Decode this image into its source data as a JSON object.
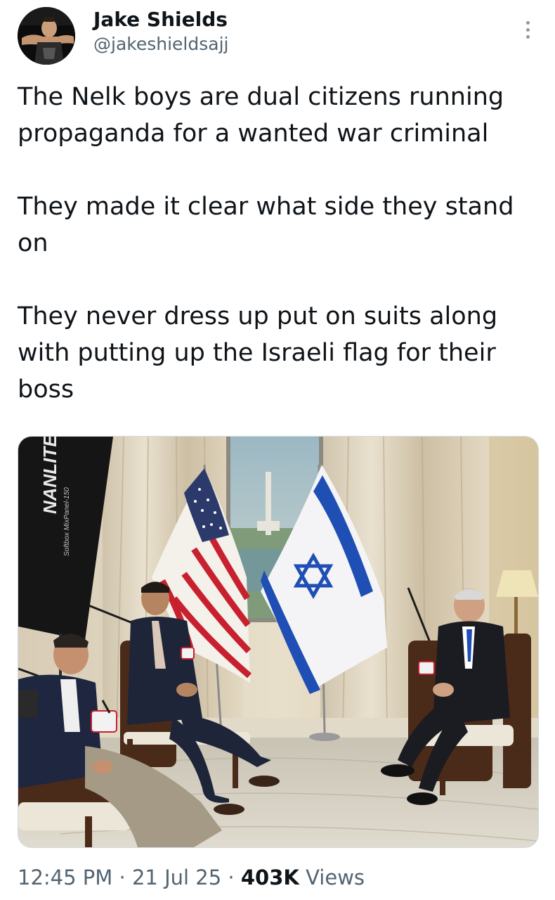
{
  "author": {
    "display_name": "Jake Shields",
    "handle": "@jakeshieldsajj",
    "avatar_icon": "profile-photo"
  },
  "tweet": {
    "paragraphs": [
      "The Nelk boys are dual citizens running propaganda for a wanted war criminal",
      "They made it clear what side they stand on",
      "They never dress up put on suits along with putting up the Israeli flag for their boss"
    ]
  },
  "media": {
    "softbox_brand": "NANLITE",
    "softbox_model": "Softbox MixPanel-150"
  },
  "meta": {
    "time": "12:45 PM",
    "separator": "·",
    "date": "21 Jul 25",
    "views_count": "403K",
    "views_label": "Views"
  },
  "colors": {
    "text": "#0f1419",
    "secondary": "#536471",
    "israel_blue": "#1f4fb4",
    "us_red": "#c8202f",
    "us_blue": "#2b3a6b"
  },
  "icons": {
    "more": "more-vertical-icon"
  }
}
